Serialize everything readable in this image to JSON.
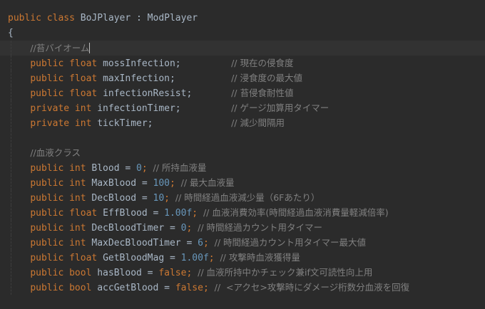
{
  "editor": {
    "colors": {
      "background": "#2b2b2b",
      "keyword": "#cc7832",
      "text": "#a9b7c6",
      "number": "#6897bb",
      "comment": "#808080",
      "current_line": "#323232"
    },
    "lines": [
      [
        {
          "k": "keyword",
          "t": "public class "
        },
        {
          "k": "text",
          "t": "BoJPlayer : ModPlayer"
        }
      ],
      [
        {
          "k": "text",
          "t": "{"
        }
      ],
      [
        {
          "k": "text",
          "t": "    "
        },
        {
          "k": "comment",
          "t": "//苔バイオーム"
        }
      ],
      [
        {
          "k": "text",
          "t": "    "
        },
        {
          "k": "keyword",
          "t": "public float "
        },
        {
          "k": "text",
          "t": "mossInfection;         "
        },
        {
          "k": "comment",
          "t": "// 現在の侵食度"
        }
      ],
      [
        {
          "k": "text",
          "t": "    "
        },
        {
          "k": "keyword",
          "t": "public float "
        },
        {
          "k": "text",
          "t": "maxInfection;          "
        },
        {
          "k": "comment",
          "t": "// 浸食度の最大値"
        }
      ],
      [
        {
          "k": "text",
          "t": "    "
        },
        {
          "k": "keyword",
          "t": "public float "
        },
        {
          "k": "text",
          "t": "infectionResist;       "
        },
        {
          "k": "comment",
          "t": "// 苔侵食耐性値"
        }
      ],
      [
        {
          "k": "text",
          "t": "    "
        },
        {
          "k": "keyword",
          "t": "private int "
        },
        {
          "k": "text",
          "t": "infectionTimer;         "
        },
        {
          "k": "comment",
          "t": "// ゲージ加算用タイマー"
        }
      ],
      [
        {
          "k": "text",
          "t": "    "
        },
        {
          "k": "keyword",
          "t": "private int "
        },
        {
          "k": "text",
          "t": "tickTimer;              "
        },
        {
          "k": "comment",
          "t": "// 減少間隔用"
        }
      ],
      [],
      [
        {
          "k": "text",
          "t": "    "
        },
        {
          "k": "comment",
          "t": "//血液クラス"
        }
      ],
      [
        {
          "k": "text",
          "t": "    "
        },
        {
          "k": "keyword",
          "t": "public int "
        },
        {
          "k": "text",
          "t": "Blood = "
        },
        {
          "k": "number",
          "t": "0"
        },
        {
          "k": "keyword",
          "t": "; "
        },
        {
          "k": "comment",
          "t": "// 所持血液量"
        }
      ],
      [
        {
          "k": "text",
          "t": "    "
        },
        {
          "k": "keyword",
          "t": "public int "
        },
        {
          "k": "text",
          "t": "MaxBlood = "
        },
        {
          "k": "number",
          "t": "100"
        },
        {
          "k": "keyword",
          "t": "; "
        },
        {
          "k": "comment",
          "t": "// 最大血液量"
        }
      ],
      [
        {
          "k": "text",
          "t": "    "
        },
        {
          "k": "keyword",
          "t": "public int "
        },
        {
          "k": "text",
          "t": "DecBlood = "
        },
        {
          "k": "number",
          "t": "10"
        },
        {
          "k": "keyword",
          "t": "; "
        },
        {
          "k": "comment",
          "t": "// 時間経過血液減少量（6Fあたり）"
        }
      ],
      [
        {
          "k": "text",
          "t": "    "
        },
        {
          "k": "keyword",
          "t": "public float "
        },
        {
          "k": "text",
          "t": "EffBlood = "
        },
        {
          "k": "number",
          "t": "1.00f"
        },
        {
          "k": "keyword",
          "t": "; "
        },
        {
          "k": "comment",
          "t": "// 血液消費効率(時間経過血液消費量軽減倍率)"
        }
      ],
      [
        {
          "k": "text",
          "t": "    "
        },
        {
          "k": "keyword",
          "t": "public int "
        },
        {
          "k": "text",
          "t": "DecBloodTimer = "
        },
        {
          "k": "number",
          "t": "0"
        },
        {
          "k": "keyword",
          "t": "; "
        },
        {
          "k": "comment",
          "t": "// 時間経過カウント用タイマー"
        }
      ],
      [
        {
          "k": "text",
          "t": "    "
        },
        {
          "k": "keyword",
          "t": "public int "
        },
        {
          "k": "text",
          "t": "MaxDecBloodTimer = "
        },
        {
          "k": "number",
          "t": "6"
        },
        {
          "k": "keyword",
          "t": "; "
        },
        {
          "k": "comment",
          "t": "// 時間経過カウント用タイマー最大値"
        }
      ],
      [
        {
          "k": "text",
          "t": "    "
        },
        {
          "k": "keyword",
          "t": "public float "
        },
        {
          "k": "text",
          "t": "GetBloodMag = "
        },
        {
          "k": "number",
          "t": "1.00f"
        },
        {
          "k": "keyword",
          "t": "; "
        },
        {
          "k": "comment",
          "t": "// 攻撃時血液獲得量"
        }
      ],
      [
        {
          "k": "text",
          "t": "    "
        },
        {
          "k": "keyword",
          "t": "public bool "
        },
        {
          "k": "text",
          "t": "hasBlood = "
        },
        {
          "k": "keyword",
          "t": "false; "
        },
        {
          "k": "comment",
          "t": "// 血液所持中かチェック兼if文可読性向上用"
        }
      ],
      [
        {
          "k": "text",
          "t": "    "
        },
        {
          "k": "keyword",
          "t": "public bool "
        },
        {
          "k": "text",
          "t": "accGetBlood = "
        },
        {
          "k": "keyword",
          "t": "false; "
        },
        {
          "k": "comment",
          "t": "//  <アクセ>攻撃時にダメージ桁数分血液を回復"
        }
      ]
    ]
  }
}
